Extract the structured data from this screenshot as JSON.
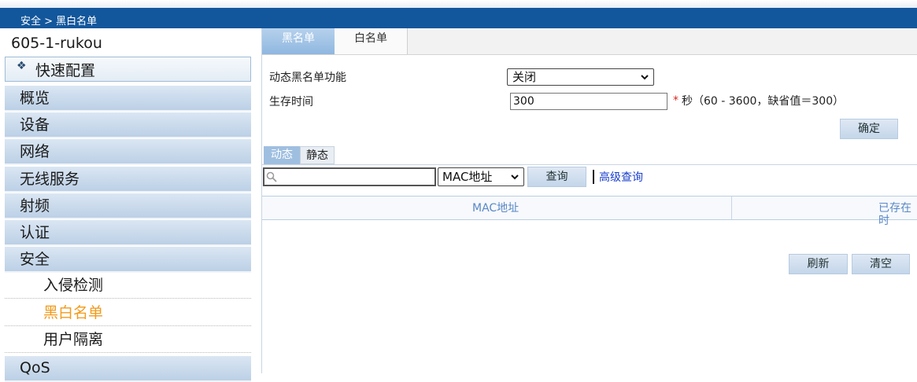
{
  "breadcrumb": "安全 > 黑白名单",
  "sidebar": {
    "device_name": "605-1-rukou",
    "quick_config": "快速配置",
    "menu": [
      "概览",
      "设备",
      "网络",
      "无线服务",
      "射频",
      "认证",
      "安全"
    ],
    "security_sub": [
      "入侵检测",
      "黑白名单",
      "用户隔离"
    ],
    "active_sub": "黑白名单",
    "more": "QoS"
  },
  "tabs": {
    "blacklist": "黑名单",
    "whitelist": "白名单"
  },
  "form": {
    "dynamic_label": "动态黑名单功能",
    "dynamic_value": "关闭",
    "ttl_label": "生存时间",
    "ttl_value": "300",
    "required_mark": "*",
    "ttl_hint": "秒（60 - 3600，缺省值＝300）",
    "confirm": "确定"
  },
  "subtabs": {
    "dynamic": "动态",
    "static": "静态"
  },
  "search": {
    "placeholder": "",
    "field_value": "MAC地址",
    "query": "查询",
    "advanced": "高级查询"
  },
  "table": {
    "headers": [
      "MAC地址",
      "已存在时"
    ]
  },
  "actions": {
    "refresh": "刷新",
    "clear": "清空"
  },
  "colors": {
    "header": "#12579c",
    "active_menu": "#f29a1b",
    "link": "#1a3fcc",
    "required": "#d9261c"
  }
}
